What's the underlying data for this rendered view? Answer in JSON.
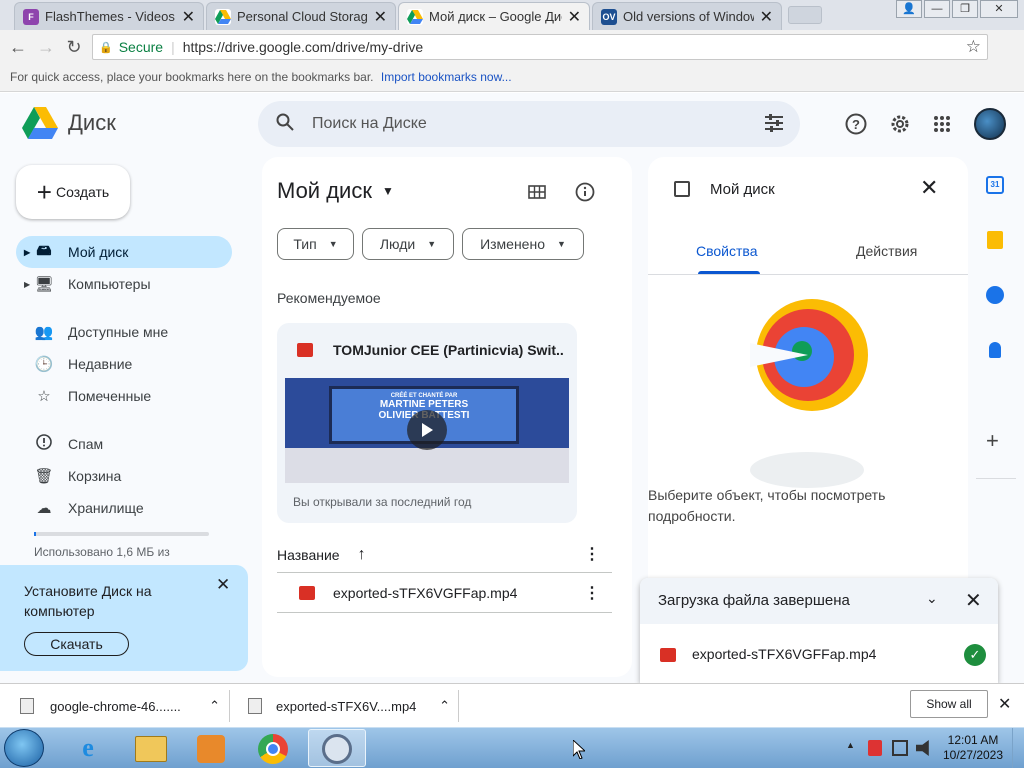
{
  "tabs": [
    {
      "title": "FlashThemes - Videos",
      "fav_text": "F",
      "fav_color": "#8e44ad"
    },
    {
      "title": "Personal Cloud Storage &",
      "fav_text": "▲",
      "fav_color": "#1a73e8"
    },
    {
      "title": "Мой диск – Google Диск",
      "fav_text": "▲",
      "fav_color": "#0f9d58"
    },
    {
      "title": "Old versions of Windows",
      "fav_text": "OV",
      "fav_color": "#1d4f91"
    }
  ],
  "close_glyph": "✕",
  "window_controls": {
    "user": "👤",
    "minimize": "—",
    "restore": "❐",
    "close": "✕"
  },
  "nav": {
    "back": "←",
    "forward": "→",
    "reload": "↻"
  },
  "omnibox": {
    "secure_label": "Secure",
    "url": "https://drive.google.com/drive/my-drive",
    "star": "☆"
  },
  "bookmarks_bar": {
    "text": "For quick access, place your bookmarks here on the bookmarks bar.",
    "link": "Import bookmarks now..."
  },
  "drive": {
    "app_name": "Диск",
    "search_placeholder": "Поиск на Диске",
    "create_label": "Создать",
    "sidebar": [
      {
        "label": "Мой диск",
        "icon": "🖴",
        "name": "my-drive"
      },
      {
        "label": "Компьютеры",
        "icon": "🖥",
        "name": "computers"
      },
      {
        "label": "Доступные мне",
        "icon": "👥",
        "name": "shared"
      },
      {
        "label": "Недавние",
        "icon": "🕒",
        "name": "recent"
      },
      {
        "label": "Помеченные",
        "icon": "☆",
        "name": "starred"
      },
      {
        "label": "Спам",
        "icon": "⓵",
        "name": "spam"
      },
      {
        "label": "Корзина",
        "icon": "🗑",
        "name": "trash"
      },
      {
        "label": "Хранилище",
        "icon": "☁",
        "name": "storage"
      }
    ],
    "storage_text": "Использовано 1,6 МБ из",
    "storage_used_fraction": 0.01,
    "install_promo": {
      "text": "Установите Диск на компьютер",
      "button": "Скачать"
    },
    "main": {
      "title": "Мой диск",
      "filters": [
        "Тип",
        "Люди",
        "Изменено"
      ],
      "recommended_label": "Рекомендуемое",
      "card": {
        "file_name": "TOMJunior CEE (Partinicvia) Swit...",
        "subtitle": "Вы открывали за последний год",
        "thumb_line1": "CRÉÉ ET CHANTÉ PAR",
        "thumb_line2": "MARTINE PETERS",
        "thumb_line3": "OLIVIER BATTESTI"
      },
      "list_header": "Название",
      "files": [
        "exported-sTFX6VGFFap.mp4"
      ]
    },
    "details": {
      "title": "Мой диск",
      "tabs": [
        "Свойства",
        "Действия"
      ],
      "empty_text": "Выберите объект, чтобы посмотреть подробности."
    },
    "upload_toast": {
      "title": "Загрузка файла завершена",
      "file": "exported-sTFX6VGFFap.mp4"
    }
  },
  "downloads": {
    "items": [
      "google-chrome-46.......",
      "exported-sTFX6V....mp4"
    ],
    "show_all": "Show all"
  },
  "taskbar": {
    "time": "12:01 AM",
    "date": "10/27/2023"
  }
}
